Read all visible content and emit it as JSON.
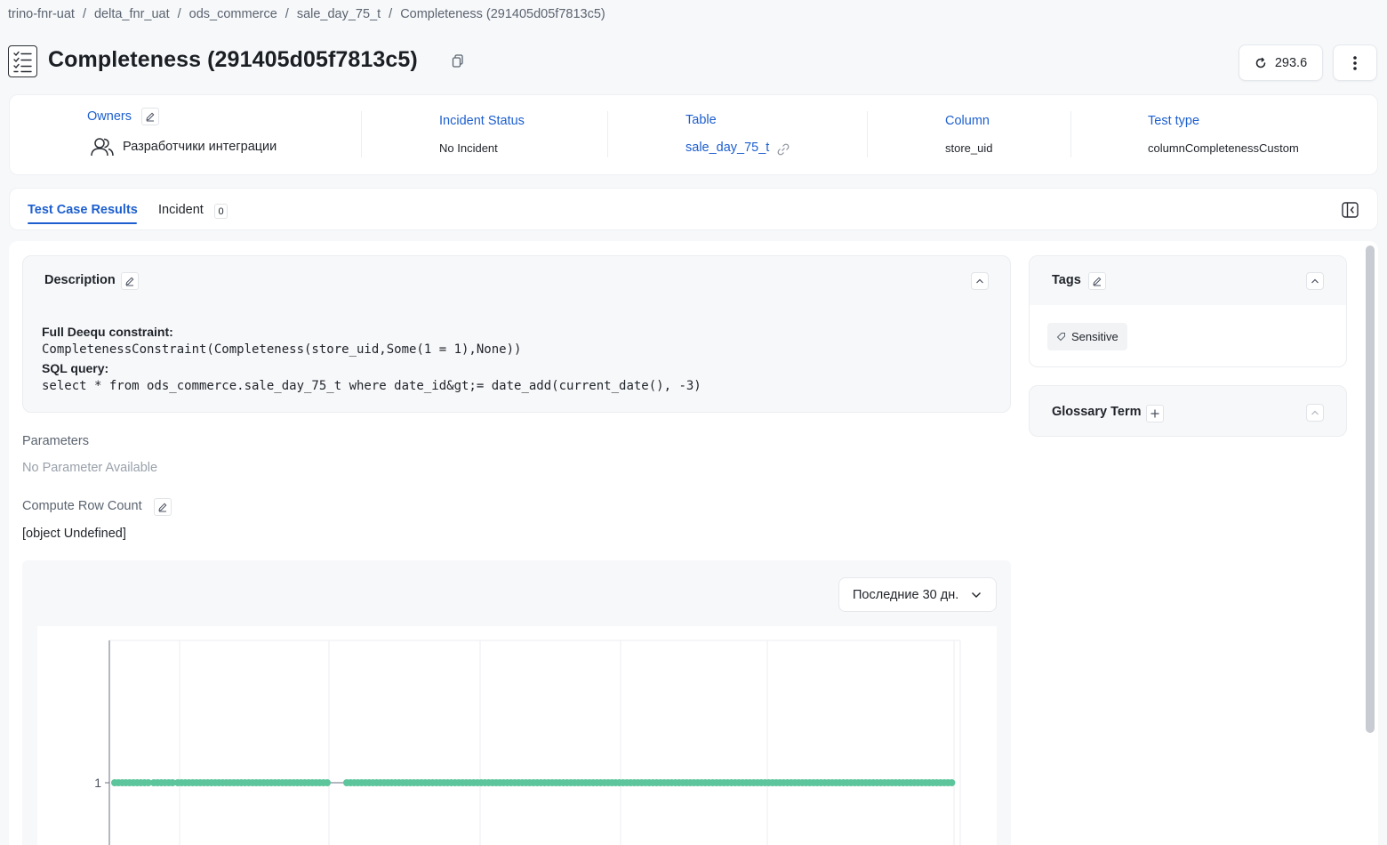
{
  "breadcrumb": {
    "items": [
      "trino-fnr-uat",
      "delta_fnr_uat",
      "ods_commerce",
      "sale_day_75_t"
    ],
    "separator": "/",
    "current": "Completeness (291405d05f7813c5)"
  },
  "header": {
    "title": "Completeness (291405d05f7813c5)",
    "refresh_value": "293.6"
  },
  "info": {
    "owners_label": "Owners",
    "owners_value": "Разработчики интеграции",
    "incident_label": "Incident Status",
    "incident_value": "No Incident",
    "table_label": "Table",
    "table_value": "sale_day_75_t",
    "column_label": "Column",
    "column_value": "store_uid",
    "test_type_label": "Test type",
    "test_type_value": "columnCompletenessCustom"
  },
  "tabs": {
    "results": "Test Case Results",
    "incident": "Incident",
    "incident_count": "0"
  },
  "description": {
    "title": "Description",
    "constraint_heading": "Full Deequ constraint:",
    "constraint": "CompletenessConstraint(Completeness(store_uid,Some(1 = 1),None))",
    "sql_heading": "SQL query:",
    "sql": "select * from ods_commerce.sale_day_75_t where date_id&gt;= date_add(current_date(), -3)"
  },
  "parameters": {
    "label": "Parameters",
    "value": "No Parameter Available"
  },
  "compute_row_count": {
    "label": "Compute Row Count",
    "value": "[object Undefined]"
  },
  "date_range": {
    "selected": "Последние 30 дн."
  },
  "tags": {
    "title": "Tags",
    "items": [
      "Sensitive"
    ]
  },
  "glossary": {
    "title": "Glossary Term"
  },
  "colors": {
    "accent": "#1d5fcf",
    "series": "#5cc59b"
  },
  "chart_data": {
    "type": "line",
    "yticks": [
      "1"
    ],
    "series": [
      {
        "values": [
          1
        ]
      }
    ]
  }
}
